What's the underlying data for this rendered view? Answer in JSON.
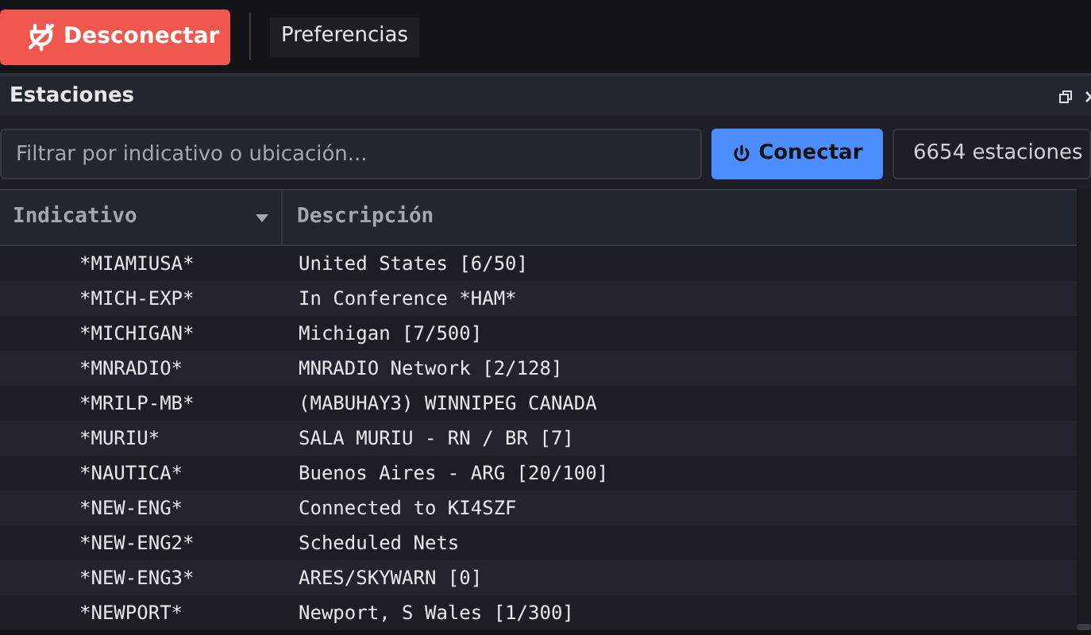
{
  "toolbar": {
    "disconnect_button": "Desconectar",
    "preferences_button": "Preferencias"
  },
  "panel": {
    "title": "Estaciones"
  },
  "filter": {
    "placeholder": "Filtrar por indicativo o ubicación..."
  },
  "connect_button": "Conectar",
  "station_count": "6654 estaciones",
  "table": {
    "columns": [
      "Indicativo",
      "Descripción"
    ],
    "rows": [
      {
        "callsign": "*MIAMIUSA*",
        "description": "United States [6/50]"
      },
      {
        "callsign": "*MICH-EXP*",
        "description": "In Conference *HAM*"
      },
      {
        "callsign": "*MICHIGAN*",
        "description": "Michigan [7/500]"
      },
      {
        "callsign": "*MNRADIO*",
        "description": "MNRADIO Network [2/128]"
      },
      {
        "callsign": "*MRILP-MB*",
        "description": "(MABUHAY3) WINNIPEG CANADA"
      },
      {
        "callsign": "*MURIU*",
        "description": "SALA MURIU - RN / BR [7]"
      },
      {
        "callsign": "*NAUTICA*",
        "description": "Buenos Aires - ARG [20/100]"
      },
      {
        "callsign": "*NEW-ENG*",
        "description": "Connected to KI4SZF"
      },
      {
        "callsign": "*NEW-ENG2*",
        "description": "Scheduled Nets"
      },
      {
        "callsign": "*NEW-ENG3*",
        "description": "ARES/SKYWARN [0]"
      },
      {
        "callsign": "*NEWPORT*",
        "description": "Newport, S Wales [1/300]"
      }
    ]
  }
}
